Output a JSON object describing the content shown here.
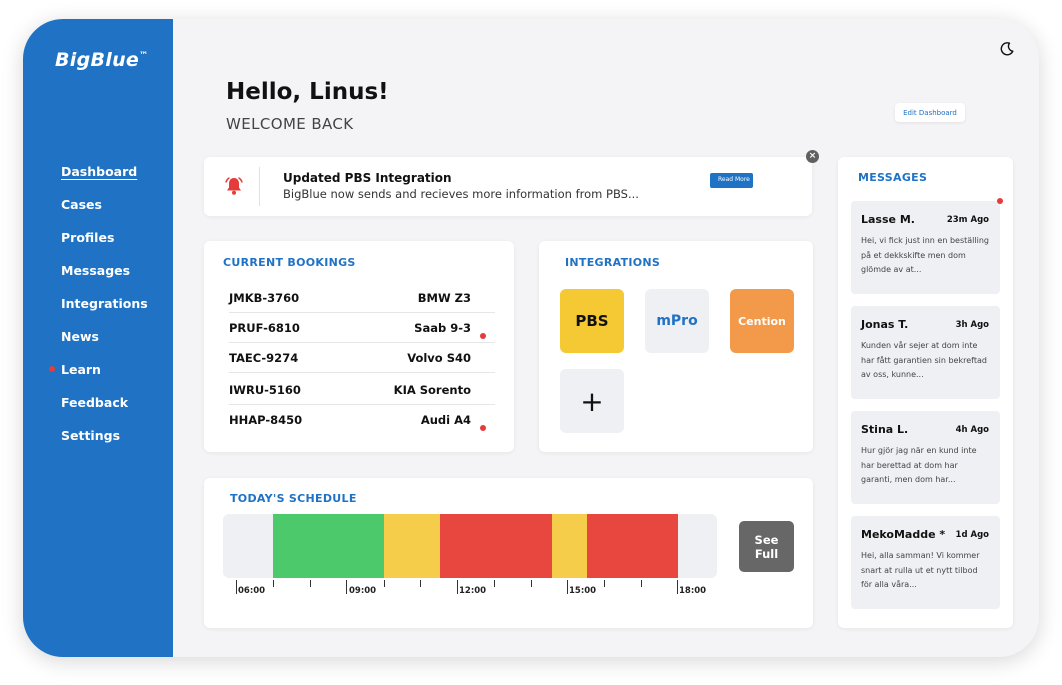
{
  "app": {
    "logo": "BigBlue",
    "logo_mark": "™"
  },
  "sidebar": {
    "items": [
      {
        "label": "Dashboard"
      },
      {
        "label": "Cases"
      },
      {
        "label": "Profiles"
      },
      {
        "label": "Messages"
      },
      {
        "label": "Integrations"
      },
      {
        "label": "News"
      },
      {
        "label": "Learn"
      },
      {
        "label": "Feedback"
      },
      {
        "label": "Settings"
      }
    ]
  },
  "header": {
    "greeting": "Hello, Linus!",
    "welcome": "WELCOME BACK",
    "edit_label": "Edit Dashboard",
    "theme_icon": "moon-icon"
  },
  "notification": {
    "title": "Updated PBS Integration",
    "body": "BigBlue now sends and recieves more information from PBS...",
    "read_label": "Read More",
    "icon": "bell-icon",
    "close_label": "×"
  },
  "bookings": {
    "title": "CURRENT BOOKINGS",
    "rows": [
      {
        "plate": "JMKB-3760",
        "car": "BMW Z3"
      },
      {
        "plate": "PRUF-6810",
        "car": "Saab 9-3"
      },
      {
        "plate": "TAEC-9274",
        "car": "Volvo S40"
      },
      {
        "plate": "IWRU-5160",
        "car": "KIA Sorento"
      },
      {
        "plate": "HHAP-8450",
        "car": "Audi A4"
      }
    ]
  },
  "integrations": {
    "title": "INTEGRATIONS",
    "tiles": [
      {
        "label": "PBS",
        "color": "#f5c934"
      },
      {
        "label": "mPro",
        "color": "#eef0f3"
      },
      {
        "label": "Cention",
        "color": "#f29a4a"
      }
    ],
    "add_label": "+"
  },
  "schedule": {
    "title": "TODAY'S SCHEDULE",
    "see_full_label": "See Full",
    "times": [
      "06:00",
      "09:00",
      "12:00",
      "15:00",
      "18:00"
    ],
    "colors": {
      "free": "#4cc96a",
      "partial": "#f5cd4a",
      "full": "#e8473f",
      "empty": "#eef0f3"
    }
  },
  "messages": {
    "title": "MESSAGES",
    "items": [
      {
        "name": "Lasse M.",
        "time": "23m Ago",
        "text": "Hei, vi fick just inn en beställing på et dekkskifte men dom glömde av at..."
      },
      {
        "name": "Jonas T.",
        "time": "3h Ago",
        "text": "Kunden vår sejer at dom inte har fått garantien sin bekreftad av oss, kunne..."
      },
      {
        "name": "Stina L.",
        "time": "4h Ago",
        "text": "Hur gjör jag när en kund inte har berettad at dom har garanti, men dom har..."
      },
      {
        "name": "MekoMadde *",
        "time": "1d Ago",
        "text": "Hei, alla samman! Vi kommer snart at rulla ut et nytt tilbod för alla våra..."
      }
    ]
  },
  "colors": {
    "brand": "#1f72c4",
    "alert": "#e53b3b"
  }
}
